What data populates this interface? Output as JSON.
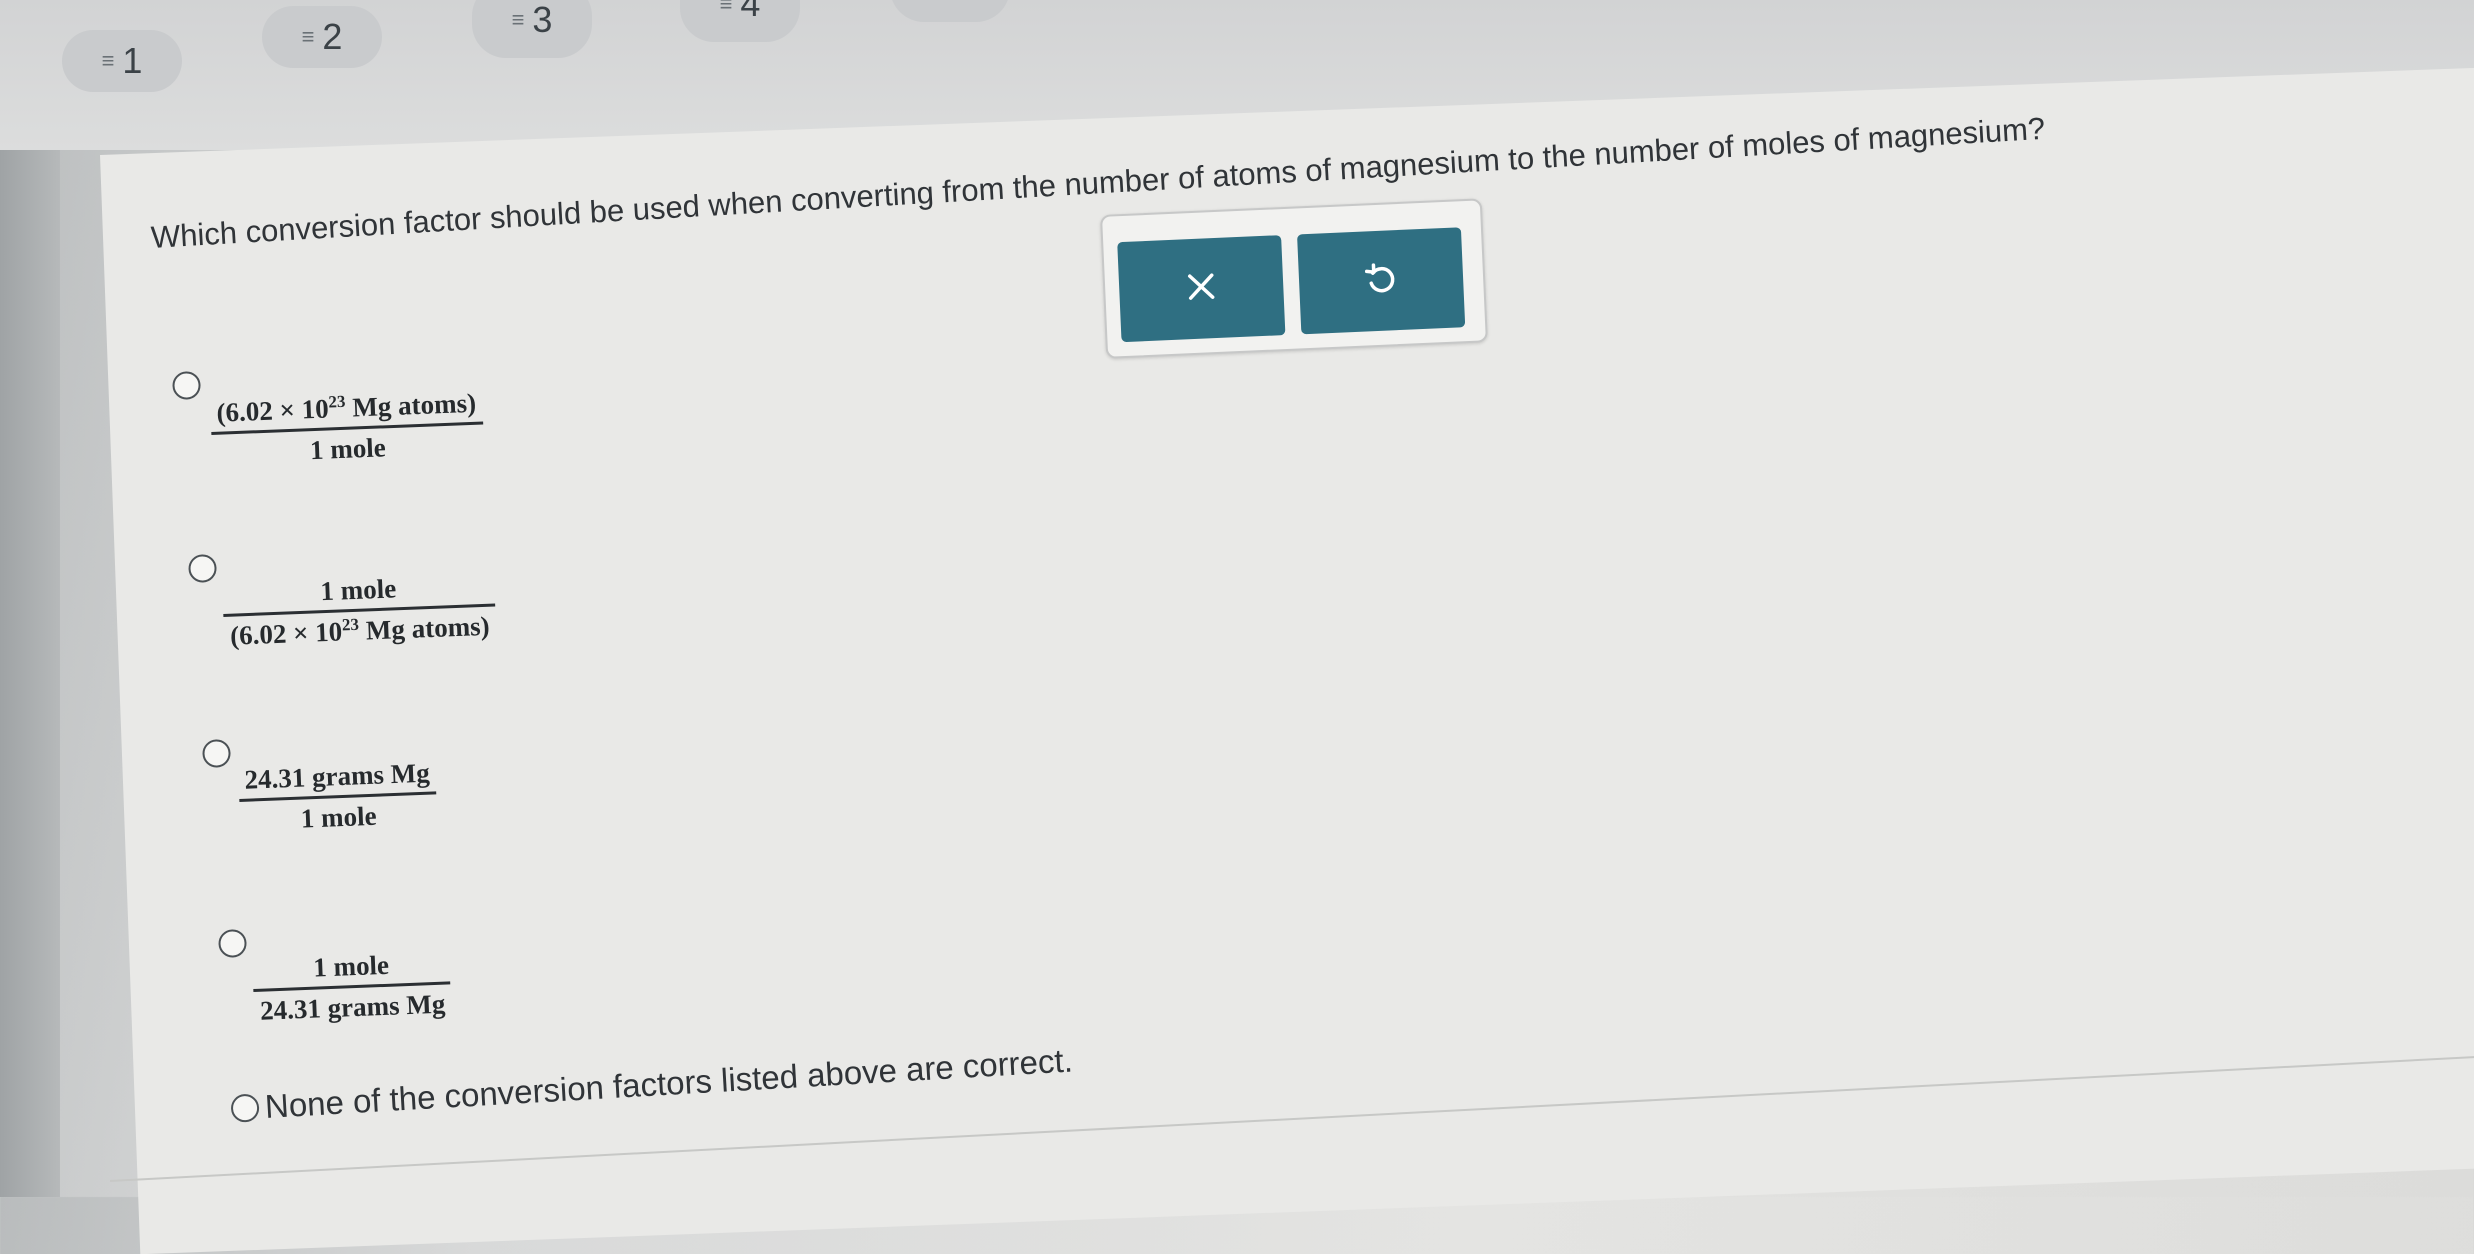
{
  "question_nav": [
    {
      "icon": "list-icon",
      "label": "1"
    },
    {
      "icon": "list-icon",
      "label": "2"
    },
    {
      "icon": "list-icon",
      "label": "3"
    },
    {
      "icon": "list-icon",
      "label": "4"
    }
  ],
  "question": {
    "text": "Which conversion factor should be used when converting from the number of atoms of magnesium to the number of moles of magnesium?"
  },
  "tools": {
    "clear_icon": "close-icon",
    "undo_icon": "undo-icon",
    "button_color": "#2f6f82"
  },
  "options": [
    {
      "numerator_prefix": "(6.02 × 10",
      "numerator_exp": "23",
      "numerator_suffix": " Mg atoms)",
      "denominator": "1 mole"
    },
    {
      "numerator": "1 mole",
      "denominator_prefix": "(6.02 × 10",
      "denominator_exp": "23",
      "denominator_suffix": " Mg atoms)"
    },
    {
      "numerator": "24.31 grams Mg",
      "denominator": "1 mole"
    },
    {
      "numerator": "1 mole",
      "denominator": "24.31 grams Mg"
    },
    {
      "label": "None of the conversion factors listed above are correct."
    }
  ]
}
